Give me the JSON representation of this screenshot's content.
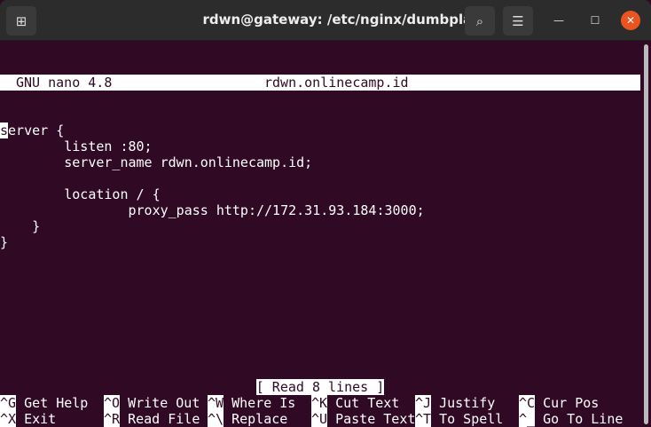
{
  "window": {
    "title": "rdwn@gateway: /etc/nginx/dumbplay"
  },
  "nano": {
    "version": "GNU nano 4.8",
    "filename": "rdwn.onlinecamp.id",
    "lines": [
      "server {",
      "        listen :80;",
      "        server_name rdwn.onlinecamp.id;",
      "",
      "        location / {",
      "                proxy_pass http://172.31.93.184:3000;",
      "    }",
      "}"
    ],
    "status": "[ Read 8 lines ]",
    "shortcuts_row1": [
      {
        "key": "^G",
        "label": "Get Help"
      },
      {
        "key": "^O",
        "label": "Write Out"
      },
      {
        "key": "^W",
        "label": "Where Is"
      },
      {
        "key": "^K",
        "label": "Cut Text"
      },
      {
        "key": "^J",
        "label": "Justify"
      },
      {
        "key": "^C",
        "label": "Cur Pos"
      }
    ],
    "shortcuts_row2": [
      {
        "key": "^X",
        "label": "Exit"
      },
      {
        "key": "^R",
        "label": "Read File"
      },
      {
        "key": "^\\",
        "label": "Replace"
      },
      {
        "key": "^U",
        "label": "Paste Text"
      },
      {
        "key": "^T",
        "label": "To Spell"
      },
      {
        "key": "^_",
        "label": "Go To Line"
      }
    ]
  }
}
